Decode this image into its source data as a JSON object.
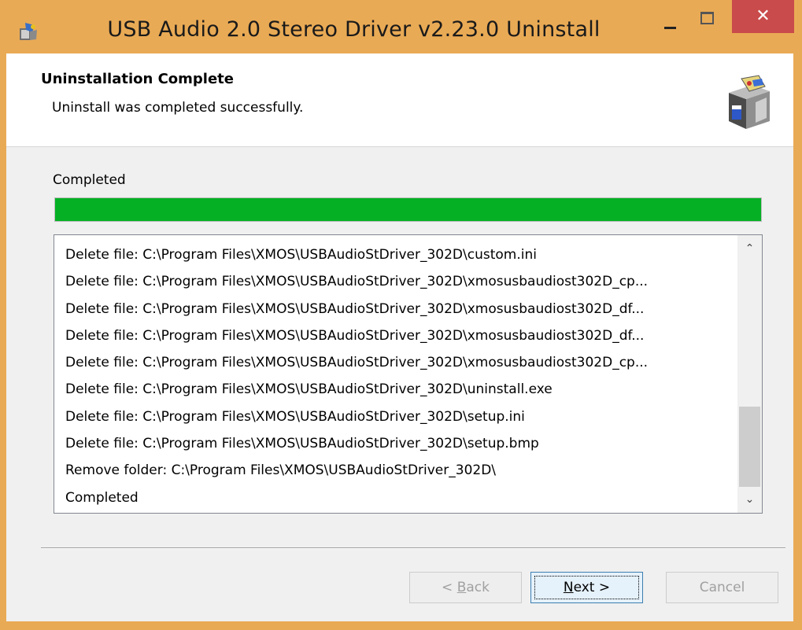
{
  "window": {
    "title": "USB Audio 2.0 Stereo Driver v2.23.0 Uninstall",
    "app_icon": "installer-icon",
    "close_glyph": "✕"
  },
  "header": {
    "title": "Uninstallation Complete",
    "subtitle": "Uninstall was completed successfully.",
    "icon": "uninstall-box-icon"
  },
  "status": {
    "label": "Completed",
    "progress_percent": 100,
    "progress_color": "#06b025"
  },
  "log": {
    "lines": [
      "Delete file: C:\\Program Files\\XMOS\\USBAudioStDriver_302D\\custom.ini",
      "Delete file: C:\\Program Files\\XMOS\\USBAudioStDriver_302D\\xmosusbaudiost302D_cp...",
      "Delete file: C:\\Program Files\\XMOS\\USBAudioStDriver_302D\\xmosusbaudiost302D_df...",
      "Delete file: C:\\Program Files\\XMOS\\USBAudioStDriver_302D\\xmosusbaudiost302D_df...",
      "Delete file: C:\\Program Files\\XMOS\\USBAudioStDriver_302D\\xmosusbaudiost302D_cp...",
      "Delete file: C:\\Program Files\\XMOS\\USBAudioStDriver_302D\\uninstall.exe",
      "Delete file: C:\\Program Files\\XMOS\\USBAudioStDriver_302D\\setup.ini",
      "Delete file: C:\\Program Files\\XMOS\\USBAudioStDriver_302D\\setup.bmp",
      "Remove folder: C:\\Program Files\\XMOS\\USBAudioStDriver_302D\\",
      "Completed"
    ]
  },
  "buttons": {
    "back_prefix": "< ",
    "back_key": "B",
    "back_rest": "ack",
    "next_key": "N",
    "next_rest": "ext >",
    "cancel": "Cancel"
  }
}
